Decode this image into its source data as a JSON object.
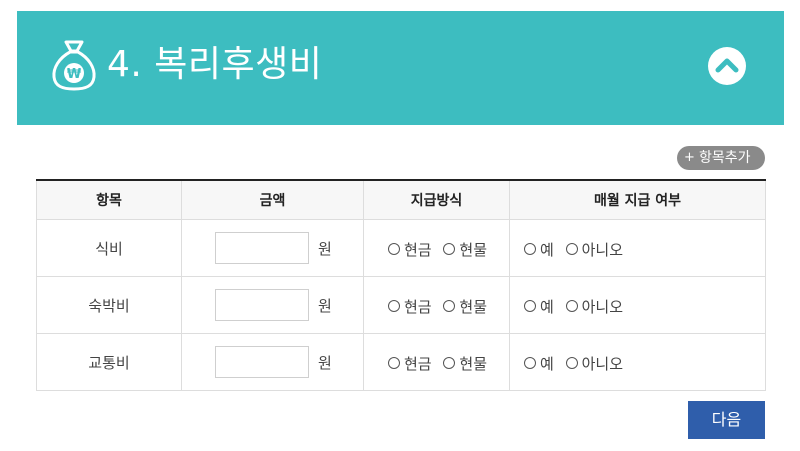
{
  "header": {
    "title": "4. 복리후생비",
    "bg_color": "#3dbdc0",
    "money_icon": "money-bag-won-icon",
    "collapse_icon": "chevron-up-icon"
  },
  "toolbar": {
    "add_item_plus": "+",
    "add_item_label": "항목추가"
  },
  "table": {
    "headers": [
      "항목",
      "금액",
      "지급방식",
      "매월 지급 여부"
    ],
    "rows": [
      {
        "item": "식비",
        "amount": "",
        "unit": "원",
        "payment_options": [
          "현금",
          "현물"
        ],
        "monthly_options": [
          "예",
          "아니오"
        ]
      },
      {
        "item": "숙박비",
        "amount": "",
        "unit": "원",
        "payment_options": [
          "현금",
          "현물"
        ],
        "monthly_options": [
          "예",
          "아니오"
        ]
      },
      {
        "item": "교통비",
        "amount": "",
        "unit": "원",
        "payment_options": [
          "현금",
          "현물"
        ],
        "monthly_options": [
          "예",
          "아니오"
        ]
      }
    ]
  },
  "footer": {
    "next_label": "다음",
    "next_color": "#2f5eab"
  }
}
